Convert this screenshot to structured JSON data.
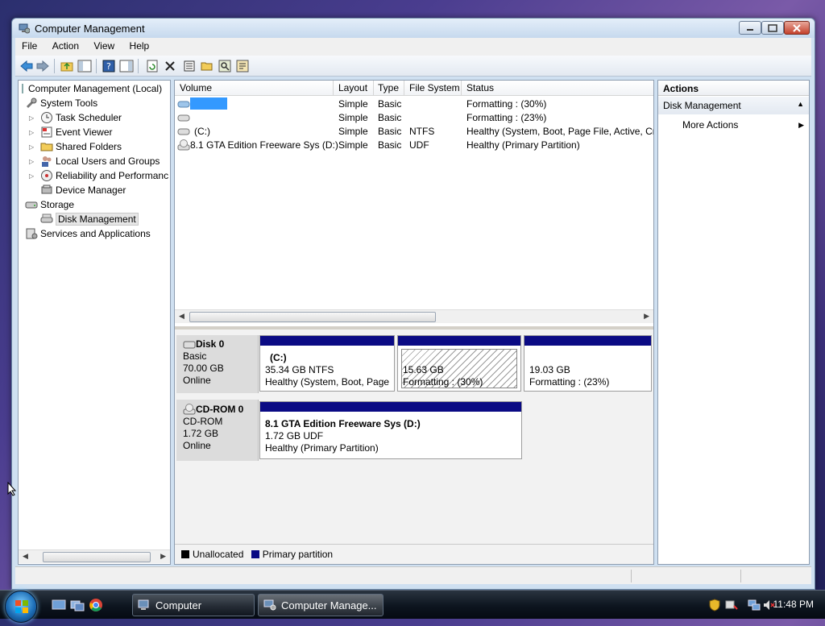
{
  "window": {
    "title": "Computer Management",
    "menu": [
      "File",
      "Action",
      "View",
      "Help"
    ]
  },
  "tree": {
    "root": "Computer Management (Local)",
    "items": [
      {
        "label": "System Tools",
        "level": 1
      },
      {
        "label": "Task Scheduler",
        "level": 2
      },
      {
        "label": "Event Viewer",
        "level": 2
      },
      {
        "label": "Shared Folders",
        "level": 2
      },
      {
        "label": "Local Users and Groups",
        "level": 2
      },
      {
        "label": "Reliability and Performanc",
        "level": 2
      },
      {
        "label": "Device Manager",
        "level": 2
      },
      {
        "label": "Storage",
        "level": 1
      },
      {
        "label": "Disk Management",
        "level": 2,
        "selected": true
      },
      {
        "label": "Services and Applications",
        "level": 1
      }
    ]
  },
  "volumes": {
    "columns": [
      "Volume",
      "Layout",
      "Type",
      "File System",
      "Status"
    ],
    "rows": [
      {
        "volume": "",
        "layout": "Simple",
        "type": "Basic",
        "fs": "",
        "status": "Formatting : (30%)"
      },
      {
        "volume": "",
        "layout": "Simple",
        "type": "Basic",
        "fs": "",
        "status": "Formatting : (23%)"
      },
      {
        "volume": "(C:)",
        "layout": "Simple",
        "type": "Basic",
        "fs": "NTFS",
        "status": "Healthy (System, Boot, Page File, Active, Cra"
      },
      {
        "volume": "8.1 GTA Edition Freeware Sys (D:)",
        "layout": "Simple",
        "type": "Basic",
        "fs": "UDF",
        "status": "Healthy (Primary Partition)"
      }
    ]
  },
  "disks": {
    "disk0": {
      "name": "Disk 0",
      "kind": "Basic",
      "size": "70.00 GB",
      "state": "Online",
      "partitions": [
        {
          "title": "(C:)",
          "size": "35.34 GB NTFS",
          "status": "Healthy (System, Boot, Page I"
        },
        {
          "title": "",
          "size": "15.63 GB",
          "status": "Formatting : (30%)"
        },
        {
          "title": "",
          "size": "19.03 GB",
          "status": "Formatting : (23%)"
        }
      ]
    },
    "cdrom0": {
      "name": "CD-ROM 0",
      "kind": "CD-ROM",
      "size": "1.72 GB",
      "state": "Online",
      "partitions": [
        {
          "title": "8.1 GTA Edition Freeware Sys  (D:)",
          "size": "1.72 GB UDF",
          "status": "Healthy (Primary Partition)"
        }
      ]
    }
  },
  "legend": {
    "unallocated": "Unallocated",
    "primary": "Primary partition"
  },
  "actions": {
    "header": "Actions",
    "section": "Disk Management",
    "more": "More Actions"
  },
  "taskbar": {
    "buttons": [
      "Computer",
      "Computer Manage..."
    ],
    "clock": "11:48 PM"
  },
  "colors": {
    "partition_bar": "#0a0a84",
    "selection_blue": "#3399ff",
    "unallocated": "#000000"
  }
}
